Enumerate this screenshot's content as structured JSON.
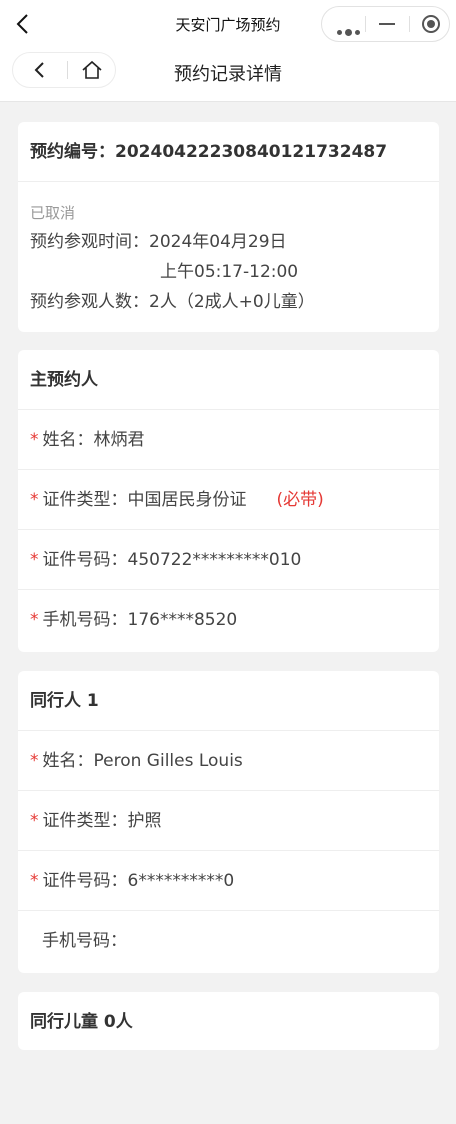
{
  "wx": {
    "title": "天安门广场预约"
  },
  "nav": {
    "title": "预约记录详情"
  },
  "booking": {
    "number_label": "预约编号：",
    "number": "20240422230840121732487",
    "status": "已取消",
    "time_label": "预约参观时间：",
    "date": "2024年04月29日",
    "time": "上午05:17-12:00",
    "count_label": "预约参观人数：",
    "count": "2人（2成人+0儿童）"
  },
  "main": {
    "heading": "主预约人",
    "name_label": "姓名：",
    "name": "林炳君",
    "idtype_label": "证件类型：",
    "idtype": "中国居民身份证",
    "must_bring": "(必带)",
    "idno_label": "证件号码：",
    "idno": "450722*********010",
    "phone_label": "手机号码：",
    "phone": "176****8520"
  },
  "companion": {
    "heading": "同行人 1",
    "name_label": "姓名：",
    "name": "Peron Gilles Louis",
    "idtype_label": "证件类型：",
    "idtype": "护照",
    "idno_label": "证件号码：",
    "idno": "6**********0",
    "phone_label": "手机号码：",
    "phone": ""
  },
  "children": {
    "heading": "同行儿童 0人"
  },
  "required_mark": "*"
}
